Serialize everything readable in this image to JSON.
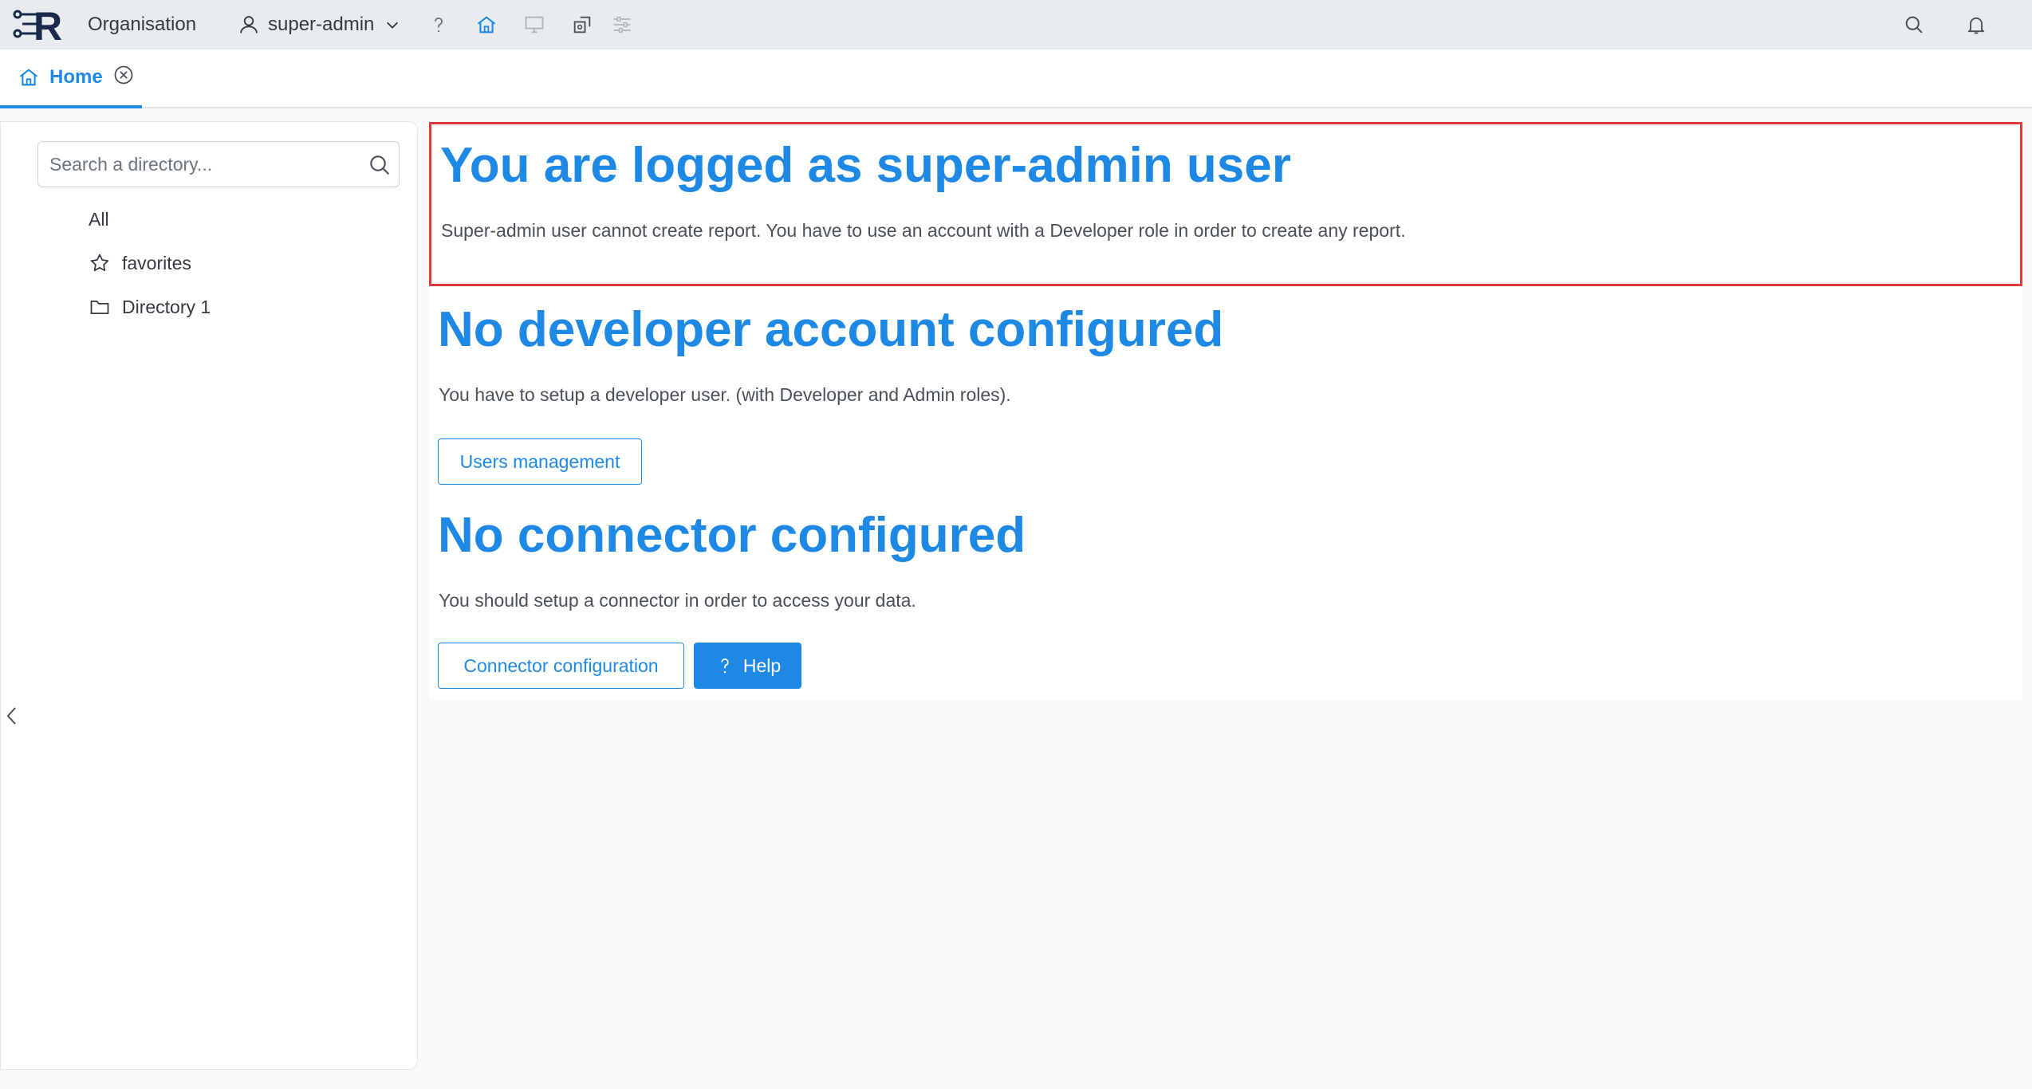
{
  "topbar": {
    "logo_letter": "R",
    "organisation": "Organisation",
    "user": "super-admin"
  },
  "tabs": [
    {
      "label": "Home"
    }
  ],
  "sidebar": {
    "search_placeholder": "Search a directory...",
    "items": [
      {
        "label": "All",
        "icon": "none"
      },
      {
        "label": "favorites",
        "icon": "star-icon"
      },
      {
        "label": "Directory 1",
        "icon": "folder-icon"
      }
    ]
  },
  "main": {
    "sections": [
      {
        "title": "You are logged as super-admin user",
        "text": "Super-admin user cannot create report. You have to use an account with a Developer role in order to create any report."
      },
      {
        "title": "No developer account configured",
        "text": "You have to setup a developer user. (with Developer and Admin roles).",
        "button": "Users management"
      },
      {
        "title": "No connector configured",
        "text": "You should setup a connector in order to access your data.",
        "button": "Connector configuration",
        "help_button": "Help"
      }
    ]
  },
  "colors": {
    "accent": "#1e88e5",
    "highlight_border": "#e0393e",
    "topbar_bg": "#e9ecef"
  }
}
